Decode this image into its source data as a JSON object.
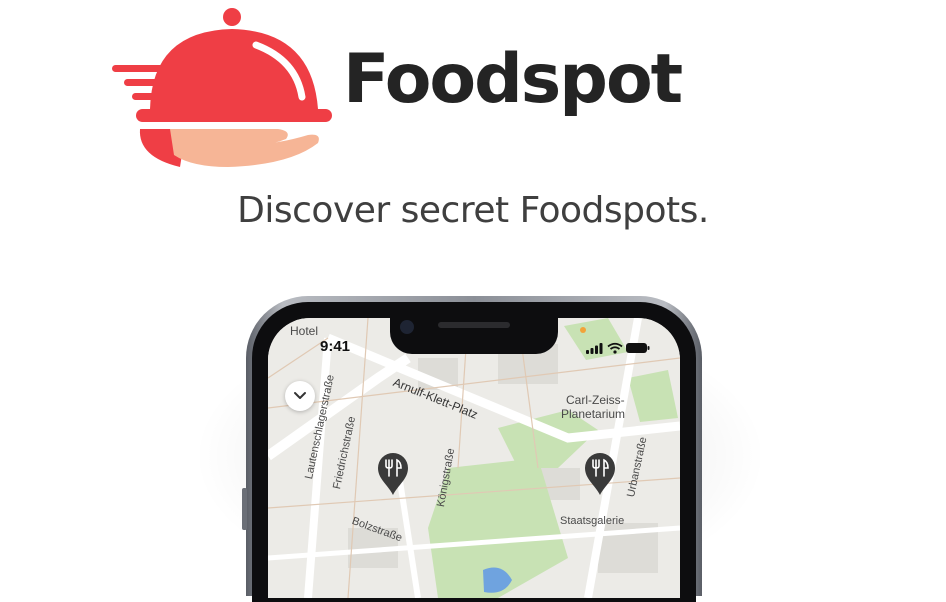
{
  "brand": {
    "name": "Foodspot",
    "tagline": "Discover secret Foodspots."
  },
  "colors": {
    "brand_red": "#ef3e45",
    "hand_peach": "#f6b596",
    "brand_text": "#242424",
    "map_bg": "#ecebe7",
    "park_green": "#c8e2b4",
    "water_blue": "#6fa3df"
  },
  "phone": {
    "status_bar": {
      "time": "9:41",
      "icons": [
        "signal-icon",
        "wifi-icon",
        "battery-icon"
      ]
    },
    "map": {
      "labels": {
        "hotel": "Hotel",
        "arnulf": "Arnulf-Klett-Platz",
        "friedrich": "Friedrichstraße",
        "carl1": "Carl-Zeiss-",
        "carl2": "Planetarium",
        "konig": "Königstraße",
        "lauter": "Lautenschlagerstraße",
        "urban": "Urbanstraße",
        "bolz": "Bolzstraße",
        "staats": "Staatsgalerie"
      },
      "pins": [
        "foodspot-pin",
        "foodspot-pin"
      ],
      "collapse_icon": "chevron-down-icon"
    }
  }
}
